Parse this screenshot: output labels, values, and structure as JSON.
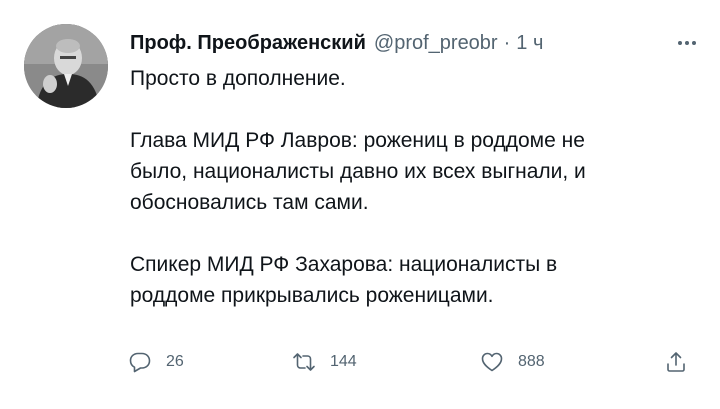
{
  "tweet": {
    "author": {
      "display_name": "Проф. Преображенский",
      "handle": "@prof_preobr",
      "separator": "·",
      "time": "1 ч"
    },
    "lines": [
      "Просто в дополнение.",
      "",
      "Глава МИД РФ Лавров: рожениц в роддоме не",
      "было, националисты давно их всех выгнали, и",
      "обосновались там сами.",
      "",
      "Спикер МИД РФ Захарова: националисты в",
      "роддоме прикрывались роженицами."
    ],
    "actions": {
      "replies": "26",
      "retweets": "144",
      "likes": "888"
    }
  },
  "icons": {
    "more": "more-horizontal-icon",
    "reply": "speech-bubble-icon",
    "retweet": "retweet-arrows-icon",
    "like": "heart-icon",
    "share": "share-upload-icon"
  },
  "colors": {
    "text": "#0f1419",
    "secondary": "#536471",
    "background": "#ffffff"
  }
}
